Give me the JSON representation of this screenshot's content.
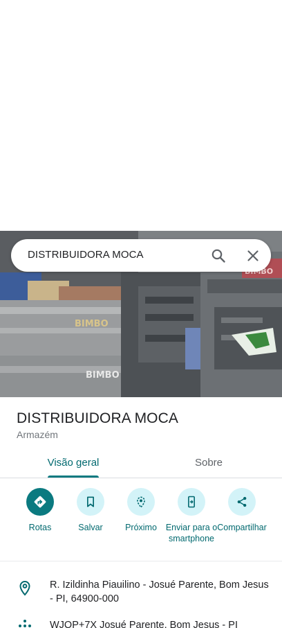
{
  "search": {
    "query": "DISTRIBUIDORA MOCA"
  },
  "place": {
    "name": "DISTRIBUIDORA MOCA",
    "category": "Armazém"
  },
  "photo": {
    "crate_brand": "BIMBO"
  },
  "tabs": [
    {
      "label": "Visão geral",
      "active": true
    },
    {
      "label": "Sobre",
      "active": false
    }
  ],
  "actions": [
    {
      "label": "Rotas",
      "icon": "directions-icon"
    },
    {
      "label": "Salvar",
      "icon": "bookmark-icon"
    },
    {
      "label": "Próximo",
      "icon": "nearby-icon"
    },
    {
      "label": "Enviar para o smartphone",
      "icon": "send-to-phone-icon"
    },
    {
      "label": "Compartilhar",
      "icon": "share-icon"
    }
  ],
  "info": {
    "address": "R. Izildinha Piauilino - Josué Parente, Bom Jesus - PI, 64900-000",
    "plus_code": "WJQP+7X Josué Parente, Bom Jesus - PI"
  },
  "colors": {
    "accent": "#0b7a80",
    "accent_text": "#01696f",
    "action_bg": "#d3f3f8"
  }
}
